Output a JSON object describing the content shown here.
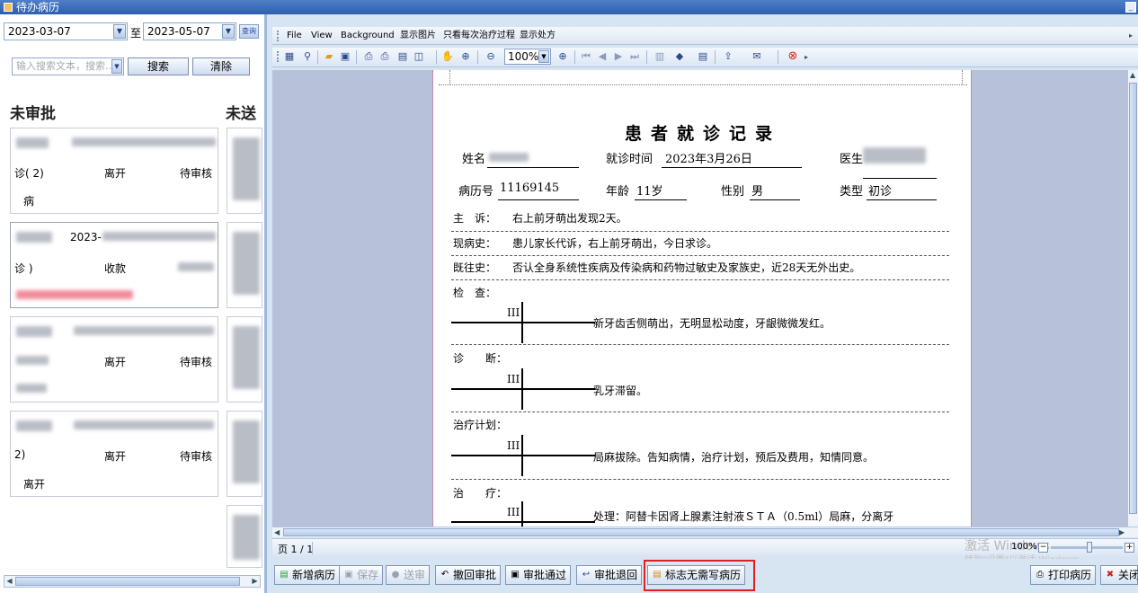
{
  "window": {
    "title": "待办病历"
  },
  "filter": {
    "date_from": "2023-03-07",
    "date_to_label": "至",
    "date_to": "2023-05-07",
    "query_label": "查询",
    "search_placeholder": "输入搜索文本，搜索...",
    "search_button": "搜索",
    "clear_button": "清除"
  },
  "columns": {
    "pending_review": "未审批",
    "not_sent": "未送"
  },
  "cards": [
    {
      "status_left": "诊(  2)",
      "action": "离开",
      "status": "待审核",
      "extra": "病"
    },
    {
      "status_left": "诊   )",
      "action": "收款",
      "status": "",
      "date": "2023-"
    },
    {
      "status_left": "   )",
      "action": "离开",
      "status": "待审核",
      "extra": ""
    },
    {
      "status_left": "   2)",
      "action": "离开",
      "status": "待审核",
      "extra": "离开"
    }
  ],
  "menu": [
    "File",
    "View",
    "Background",
    "显示图片",
    "只看每次治疗过程",
    "显示处方"
  ],
  "toolbar": {
    "zoom": "100%"
  },
  "record": {
    "title": "患者就诊记录",
    "name_label": "姓名",
    "visit_time_label": "就诊时间",
    "visit_time": "2023年3月26日",
    "doctor_label": "医生",
    "record_no_label": "病历号",
    "record_no": "11169145",
    "age_label": "年龄",
    "age": "11岁",
    "gender_label": "性别",
    "gender": "男",
    "type_label": "类型",
    "type": "初诊",
    "chief_label": "主　诉：",
    "chief": "右上前牙萌出发现2天。",
    "present_label": "现病史：",
    "present": "患儿家长代诉，右上前牙萌出，今日求诊。",
    "past_label": "既往史：",
    "past": "否认全身系统性疾病及传染病和药物过敏史及家族史，近28天无外出史。",
    "exam_label": "检　查：",
    "exam": "新牙齿舌侧萌出，无明显松动度，牙龈微微发红。",
    "diag_label": "诊　　断：",
    "diag": "乳牙滞留。",
    "plan_label": "治疗计划：",
    "plan": "局麻拔除。告知病情，治疗计划，预后及费用，知情同意。",
    "treat_label": "治　　疗：",
    "treat": "处理：阿替卡因肾上腺素注射液ＳＴＡ（0.5ml）局麻，分离牙",
    "tooth_no": "III"
  },
  "status": {
    "page": "页 1 / 1",
    "watermark_title": "激活 Windows",
    "watermark_sub": "转到\"设置\"以激活 Windows。",
    "zoom": "100%"
  },
  "buttons": {
    "new": "新增病历",
    "save": "保存",
    "send": "送审",
    "revoke": "撤回审批",
    "approve": "审批通过",
    "reject": "审批退回",
    "no_record": "标志无需写病历",
    "print": "打印病历",
    "close": "关闭"
  }
}
